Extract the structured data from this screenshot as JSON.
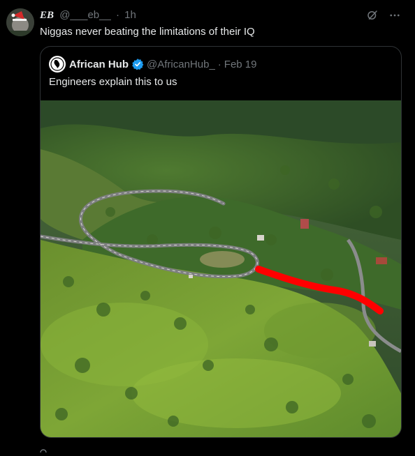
{
  "tweet": {
    "display_name": "EB",
    "handle": "@___eb__",
    "separator": "·",
    "time": "1h",
    "text": "Niggas never beating the limitations of their IQ"
  },
  "quote": {
    "display_name": "African Hub",
    "handle": "@AfricanHub_",
    "separator": "·",
    "date": "Feb 19",
    "text": "Engineers explain this to us"
  },
  "colors": {
    "background": "#000000",
    "text": "#e7e9ea",
    "muted": "#71767b",
    "border": "#2f3336",
    "verified": "#1d9bf0",
    "annotation_line": "#ff0000"
  },
  "icons": {
    "grok": "grok-icon",
    "more": "more-icon",
    "verified": "verified-badge-icon"
  }
}
